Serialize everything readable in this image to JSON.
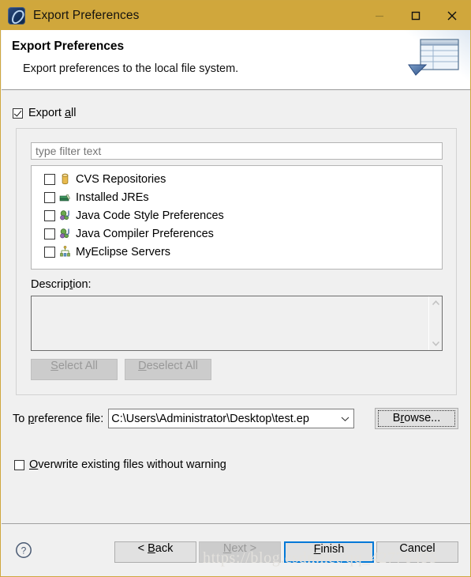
{
  "window": {
    "title": "Export Preferences",
    "icon": "myeclipse-logo-icon",
    "controls": {
      "minimize": "minimize-icon",
      "maximize": "maximize-icon",
      "close": "close-icon"
    }
  },
  "header": {
    "title": "Export Preferences",
    "description": "Export preferences to the local file system.",
    "banner_icon": "export-table-icon"
  },
  "body": {
    "export_all": {
      "label_pre": "Export ",
      "label_mnemonic": "a",
      "label_post": "ll",
      "checked": true
    },
    "filter": {
      "placeholder": "type filter text",
      "value": ""
    },
    "tree_items": [
      {
        "label": "CVS Repositories",
        "checked": false,
        "icon": "cvs-repository-icon"
      },
      {
        "label": "Installed JREs",
        "checked": false,
        "icon": "installed-jre-icon"
      },
      {
        "label": "Java Code Style Preferences",
        "checked": false,
        "icon": "java-preferences-icon"
      },
      {
        "label": "Java Compiler Preferences",
        "checked": false,
        "icon": "java-preferences-icon"
      },
      {
        "label": "MyEclipse Servers",
        "checked": false,
        "icon": "myeclipse-servers-icon"
      }
    ],
    "description_label_pre": "Descrip",
    "description_label_mnemonic": "t",
    "description_label_post": "ion:",
    "description_value": "",
    "select_all": {
      "pre": "",
      "mnemonic": "S",
      "post": "elect All",
      "enabled": false
    },
    "deselect_all": {
      "pre": "",
      "mnemonic": "D",
      "post": "eselect All",
      "enabled": false
    },
    "preference_file": {
      "label_pre": "To ",
      "label_mnemonic": "p",
      "label_post": "reference file:",
      "value": "C:\\Users\\Administrator\\Desktop\\test.ep",
      "dropdown_icon": "chevron-down-icon"
    },
    "browse": {
      "pre": "B",
      "mnemonic": "r",
      "post": "owse...",
      "focused": true
    },
    "overwrite": {
      "label_pre": "",
      "label_mnemonic": "O",
      "label_post": "verwrite existing files without warning",
      "checked": false
    }
  },
  "footer": {
    "help_icon": "help-question-icon",
    "back": {
      "pre": "< ",
      "mnemonic": "B",
      "post": "ack",
      "enabled": true,
      "default": false
    },
    "next": {
      "pre": "",
      "mnemonic": "N",
      "post": "ext >",
      "enabled": false,
      "default": false
    },
    "finish": {
      "pre": "",
      "mnemonic": "F",
      "post": "inish",
      "enabled": true,
      "default": true
    },
    "cancel": {
      "pre": "",
      "mnemonic": "",
      "post": "Cancel",
      "enabled": true,
      "default": false
    }
  },
  "watermark": "https://blog.csdn.net/qq_42776455",
  "colors": {
    "titlebar": "#d0a73c",
    "dialog_border": "#cfa73e",
    "body_background": "#f0f0f0",
    "default_button_accent": "#0078d7",
    "placeholder_text": "#6d6d6d"
  }
}
